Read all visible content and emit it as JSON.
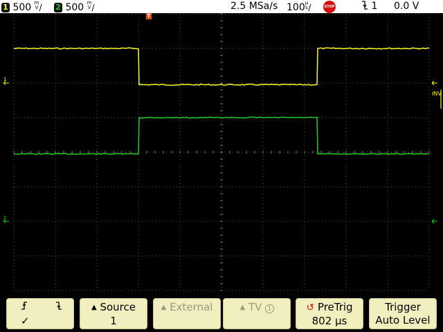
{
  "status_bar": {
    "ch1_number": "1",
    "ch1_scale": "500",
    "ch1_unit_top": "m",
    "ch1_unit_bottom": "V",
    "ch2_number": "2",
    "ch2_scale": "500",
    "ch2_unit_top": "m",
    "ch2_unit_bottom": "V",
    "sample_rate": "2.5 MSa/s",
    "timebase": "100",
    "timebase_unit_top": "µ",
    "timebase_unit_bottom": "s",
    "run_state": "STOP",
    "trigger_source": "1",
    "trigger_level": "0.0 V",
    "colors": {
      "ch1": "#ffff20",
      "ch2": "#20d020",
      "stop": "#d40f0f"
    }
  },
  "display": {
    "trigger_marker": "T",
    "ch1_marker": "1",
    "ch2_marker": "2",
    "inverted_label": "INV",
    "grid_divisions": {
      "x": 10,
      "y": 8
    },
    "traces": {
      "ch1": {
        "color": "#ffff20",
        "high_level_div": 3.0,
        "low_level_div": 1.95,
        "fall_time_div": 3.0,
        "rise_time_div": 7.3
      },
      "ch2": {
        "color": "#20d020",
        "high_level_div": 1.0,
        "low_level_div": -0.05,
        "rise_time_div": 3.0,
        "fall_time_div": 7.3
      }
    }
  },
  "softkeys": [
    {
      "name": "slope",
      "line1": "",
      "line2": "✓"
    },
    {
      "name": "source",
      "line1": "Source",
      "line2": "1"
    },
    {
      "name": "external",
      "line1": "External",
      "line2": ""
    },
    {
      "name": "tv",
      "line1": "TV",
      "line2": ""
    },
    {
      "name": "pretrig",
      "line1": "PreTrig",
      "line2": "802 µs"
    },
    {
      "name": "trigger",
      "line1": "Trigger",
      "line2": "Auto Level"
    }
  ]
}
